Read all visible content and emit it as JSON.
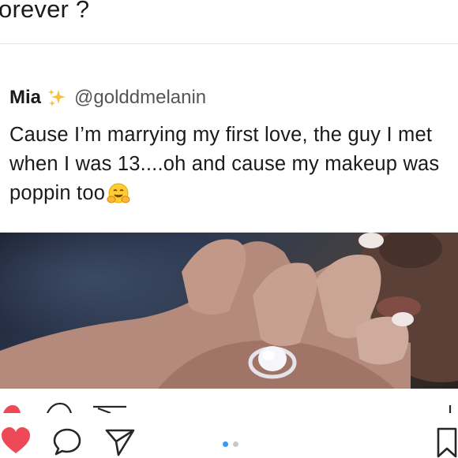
{
  "post": {
    "top_text": "orever ?"
  },
  "tweet": {
    "name": "Mia",
    "handle": "@golddmelanin",
    "text": "Cause I’m marrying my first love, the guy I met when I was 13....oh and cause my makeup was poppin too",
    "emoji_icon": "hugging-face-icon",
    "name_icon": "sparkles-icon"
  },
  "photo": {
    "description_icon": "hand-with-ring-photo"
  },
  "actions": {
    "like_icon": "heart-icon",
    "comment_icon": "comment-icon",
    "share_icon": "share-icon",
    "save_icon": "bookmark-icon",
    "carousel_index": 1,
    "carousel_count": 2
  },
  "colors": {
    "like_red": "#ed4956",
    "dot_active": "#3897f0",
    "dot_inactive": "#c8c8c8"
  }
}
